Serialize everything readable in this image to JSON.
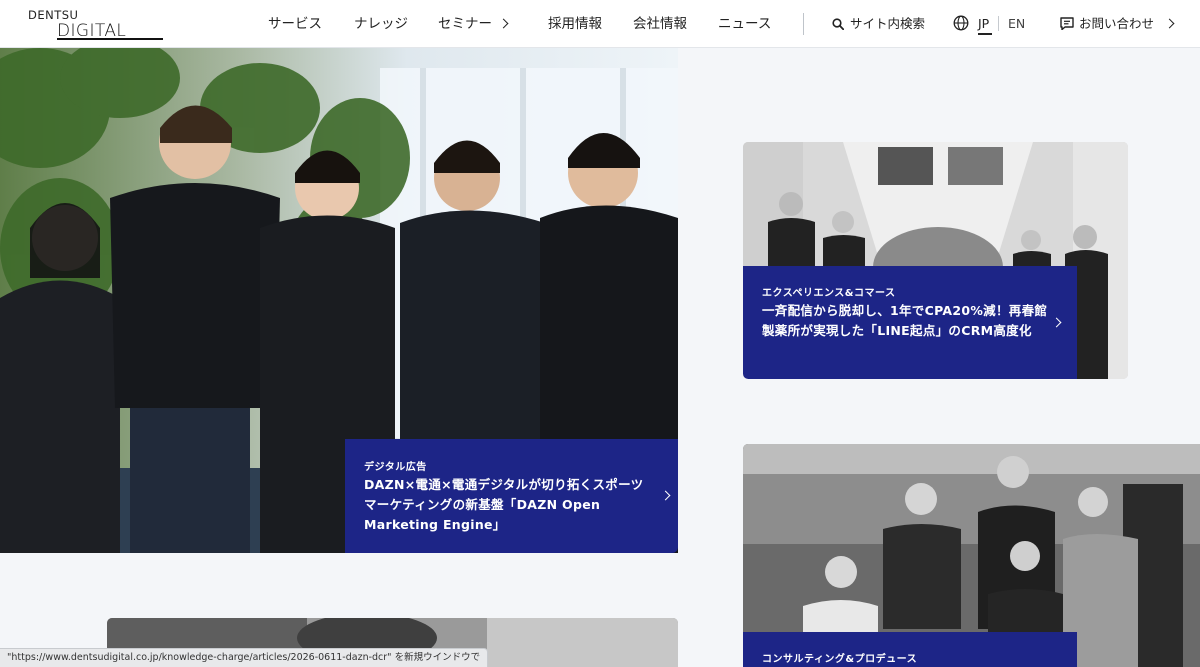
{
  "logo": {
    "line1": "DENTSU",
    "line2": "DIGITAL"
  },
  "nav": {
    "items": [
      {
        "label": "サービス"
      },
      {
        "label": "ナレッジ"
      },
      {
        "label": "セミナー"
      },
      {
        "label": "採用情報"
      },
      {
        "label": "会社情報"
      },
      {
        "label": "ニュース"
      }
    ],
    "search_label": "サイト内検索",
    "lang_jp": "JP",
    "lang_en": "EN",
    "contact_label": "お問い合わせ"
  },
  "hero": {
    "category": "デジタル広告",
    "title": "DAZN×電通×電通デジタルが切り拓くスポーツマーケティングの新基盤「DAZN Open Marketing Engine」"
  },
  "cards": [
    {
      "category": "エクスペリエンス&コマース",
      "title": "一斉配信から脱却し、1年でCPA20%減！再春館製薬所が実現した「LINE起点」のCRM高度化"
    },
    {
      "category": "コンサルティング&プロデュース",
      "title": ""
    }
  ],
  "status_bar": "\"https://www.dentsudigital.co.jp/knowledge-charge/articles/2026-0611-dazn-dcr\" を新規ウインドウで",
  "colors": {
    "accent": "#1d2587",
    "background": "#f4f6f9"
  }
}
